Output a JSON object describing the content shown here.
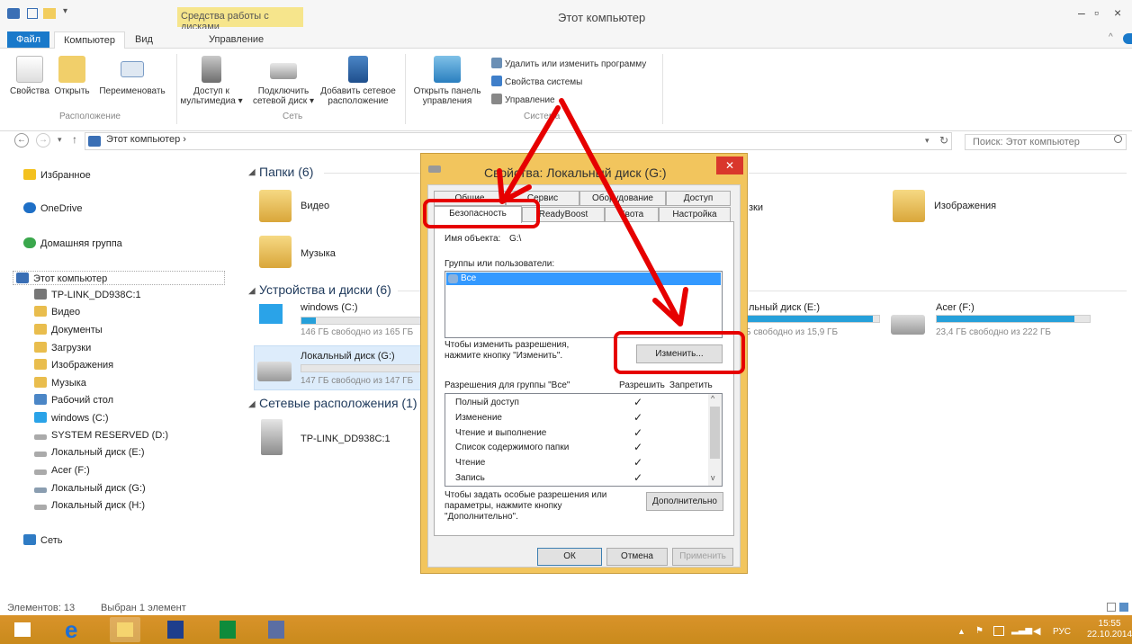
{
  "window": {
    "title": "Этот компьютер",
    "contextual_tab_group": "Средства работы с дисками"
  },
  "ribbon_tabs": {
    "file": "Файл",
    "computer": "Компьютер",
    "view": "Вид",
    "manage": "Управление"
  },
  "ribbon": {
    "location": {
      "properties": "Свойства",
      "open": "Открыть",
      "rename": "Переименовать",
      "group_label": "Расположение"
    },
    "network": {
      "media_access_1": "Доступ к",
      "media_access_2": "мультимедиа ▾",
      "map_drive_1": "Подключить",
      "map_drive_2": "сетевой диск ▾",
      "add_location_1": "Добавить сетевое",
      "add_location_2": "расположение",
      "group_label": "Сеть"
    },
    "system": {
      "control_panel_1": "Открыть панель",
      "control_panel_2": "управления",
      "uninstall": "Удалить или изменить программу",
      "sys_props": "Свойства системы",
      "manage": "Управление",
      "group_label": "Система"
    }
  },
  "address": {
    "path": "Этот компьютер  ›",
    "search_placeholder": "Поиск: Этот компьютер"
  },
  "nav": {
    "favorites": "Избранное",
    "onedrive": "OneDrive",
    "homegroup": "Домашняя группа",
    "thispc": "Этот компьютер",
    "items": [
      "TP-LINK_DD938C:1",
      "Видео",
      "Документы",
      "Загрузки",
      "Изображения",
      "Музыка",
      "Рабочий стол",
      "windows (C:)",
      "SYSTEM RESERVED (D:)",
      "Локальный диск (E:)",
      "Acer (F:)",
      "Локальный диск (G:)",
      "Локальный диск (H:)"
    ],
    "network": "Сеть"
  },
  "content": {
    "folders_header": "Папки (6)",
    "folders": {
      "video": "Видео",
      "music": "Музыка",
      "downloads_partial": "зки",
      "images": "Изображения"
    },
    "devices_header": "Устройства и диски (6)",
    "drives": {
      "c_name": "windows (C:)",
      "c_free": "146 ГБ свободно из 165 ГБ",
      "c_used_fraction": 0.12,
      "g_name": "Локальный диск (G:)",
      "g_free": "147 ГБ свободно из 147 ГБ",
      "g_used_fraction": 0.0,
      "e_name": "льный диск (E:)",
      "e_free": "Б свободно из 15,9 ГБ",
      "e_used_fraction": 0.95,
      "f_name": "Acer (F:)",
      "f_free": "23,4 ГБ свободно из 222 ГБ",
      "f_used_fraction": 0.9
    },
    "network_header": "Сетевые расположения (1)",
    "network_item": "TP-LINK_DD938C:1"
  },
  "status": {
    "count": "Элементов: 13",
    "selected": "Выбран 1 элемент"
  },
  "dialog": {
    "title": "Свойства: Локальный диск (G:)",
    "tabs_row1": [
      "Общие",
      "Сервис",
      "Оборудование",
      "Доступ"
    ],
    "tabs_row2": [
      "Безопасность",
      "ReadyBoost",
      "Квота",
      "Настройка"
    ],
    "object_name_label": "Имя объекта:",
    "object_name_value": "G:\\",
    "groups_label": "Группы или пользователи:",
    "group_all": "Все",
    "change_hint_1": "Чтобы изменить разрешения,",
    "change_hint_2": "нажмите кнопку \"Изменить\".",
    "change_button": "Изменить...",
    "perm_for": "Разрешения для группы \"Все\"",
    "allow": "Разрешить",
    "deny": "Запретить",
    "permissions": [
      "Полный доступ",
      "Изменение",
      "Чтение и выполнение",
      "Список содержимого папки",
      "Чтение",
      "Запись"
    ],
    "check": "✓",
    "advanced_hint_1": "Чтобы задать особые разрешения или",
    "advanced_hint_2": "параметры, нажмите кнопку",
    "advanced_hint_3": "\"Дополнительно\".",
    "advanced_button": "Дополнительно",
    "ok": "ОК",
    "cancel": "Отмена",
    "apply": "Применить"
  },
  "taskbar": {
    "lang": "РУС",
    "time": "15:55",
    "date": "22.10.2014"
  },
  "colors": {
    "accent": "#1979ca",
    "annotation": "#e60000",
    "taskbar": "#d9932a",
    "dialog_frame": "#f2c55d",
    "drive_bar": "#26a0da"
  }
}
